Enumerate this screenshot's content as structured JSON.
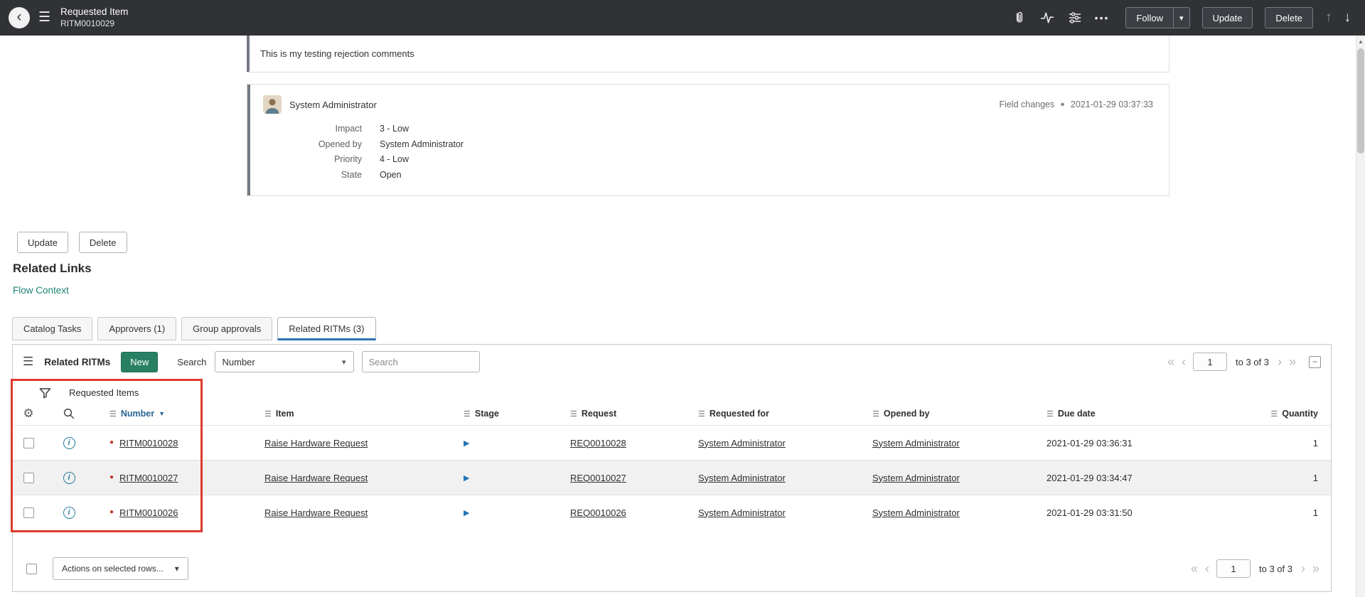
{
  "colors": {
    "header_bg": "#303236",
    "accent_teal": "#1f8476",
    "new_button_green": "#278063",
    "tab_underline_blue": "#2e74b5",
    "highlight_red": "#dd3a2b",
    "record_dot_red": "#c0392b",
    "stage_arrow_blue": "#2574b5",
    "sorted_header_blue": "#2a6592"
  },
  "icons": {
    "back": "‹",
    "menu": "☰",
    "more": "•••",
    "caret_down": "▾",
    "sort_desc": "▼",
    "scroll_up": "▲",
    "arrow_up": "↑",
    "arrow_down": "↓",
    "gear": "⚙",
    "info": "i",
    "record_dot": "●",
    "stage_play": "▶",
    "page_first": "«",
    "page_prev": "‹",
    "page_next": "›",
    "page_last": "»",
    "column_menu": "☰",
    "collapse": "−"
  },
  "header": {
    "title": "Requested Item",
    "record_number": "RITM0010029",
    "follow_label": "Follow",
    "update_label": "Update",
    "delete_label": "Delete"
  },
  "activity": {
    "comment_text": "This is my testing rejection comments",
    "entry": {
      "author": "System Administrator",
      "change_type": "Field changes",
      "timestamp": "2021-01-29 03:37:33",
      "fields": [
        {
          "label": "Impact",
          "value": "3 - Low"
        },
        {
          "label": "Opened by",
          "value": "System Administrator"
        },
        {
          "label": "Priority",
          "value": "4 - Low"
        },
        {
          "label": "State",
          "value": "Open"
        }
      ]
    }
  },
  "form_actions": {
    "update_label": "Update",
    "delete_label": "Delete"
  },
  "related_links": {
    "heading": "Related Links",
    "flow_context": "Flow Context"
  },
  "tabs": [
    {
      "label": "Catalog Tasks"
    },
    {
      "label": "Approvers (1)"
    },
    {
      "label": "Group approvals"
    },
    {
      "label": "Related RITMs (3)"
    }
  ],
  "list": {
    "title": "Related RITMs",
    "new_label": "New",
    "search_label": "Search",
    "search_field": "Number",
    "search_placeholder": "Search",
    "breadcrumb": "Requested Items",
    "columns": [
      "Number",
      "Item",
      "Stage",
      "Request",
      "Requested for",
      "Opened by",
      "Due date",
      "Quantity"
    ],
    "rows": [
      {
        "number": "RITM0010028",
        "item": "Raise Hardware Request",
        "request": "REQ0010028",
        "requested_for": "System Administrator",
        "opened_by": "System Administrator",
        "due_date": "2021-01-29 03:36:31",
        "quantity": "1"
      },
      {
        "number": "RITM0010027",
        "item": "Raise Hardware Request",
        "request": "REQ0010027",
        "requested_for": "System Administrator",
        "opened_by": "System Administrator",
        "due_date": "2021-01-29 03:34:47",
        "quantity": "1"
      },
      {
        "number": "RITM0010026",
        "item": "Raise Hardware Request",
        "request": "REQ0010026",
        "requested_for": "System Administrator",
        "opened_by": "System Administrator",
        "due_date": "2021-01-29 03:31:50",
        "quantity": "1"
      }
    ],
    "actions_label": "Actions on selected rows...",
    "pagination": {
      "page": "1",
      "range_label": "to 3 of 3"
    }
  }
}
